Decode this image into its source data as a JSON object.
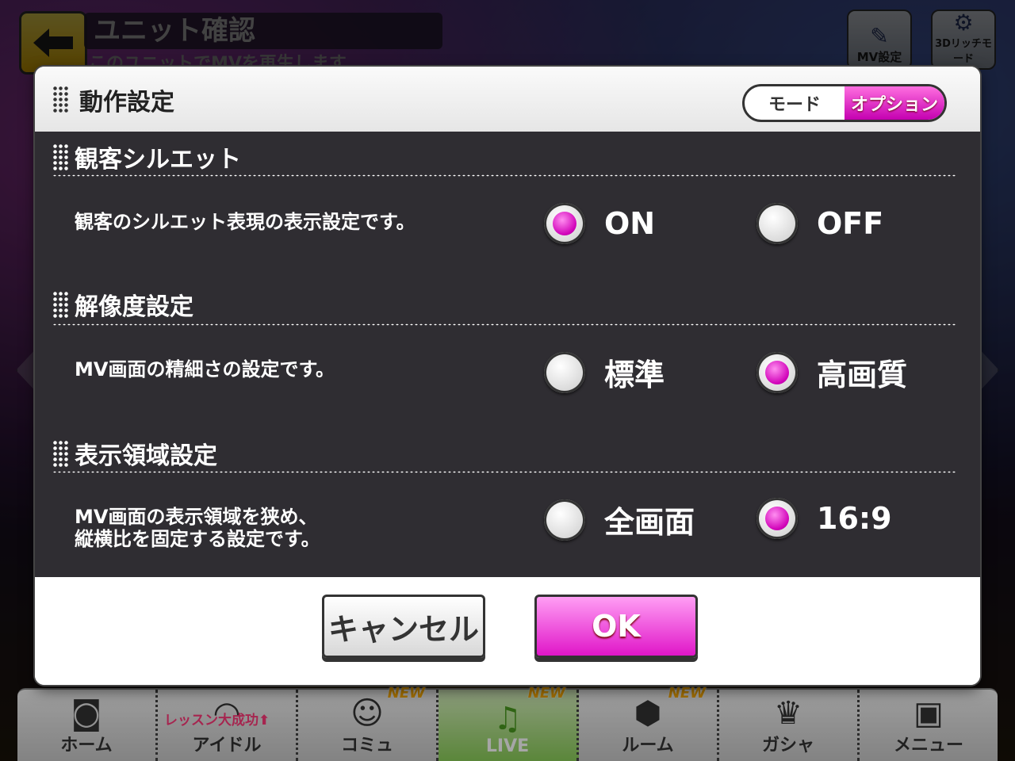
{
  "screen": {
    "title": "ユニット確認",
    "subtitle": "このユニットでMVを再生します",
    "mv_settings_label": "MV設定",
    "rich_mode_label": "3Dリッチモード"
  },
  "dialog": {
    "title": "動作設定",
    "mode_tabs": [
      {
        "label": "モード",
        "active": false
      },
      {
        "label": "オプション",
        "active": true
      }
    ],
    "sections": [
      {
        "title": "観客シルエット",
        "description": "観客のシルエット表現の表示設定です。",
        "options": [
          {
            "label": "ON",
            "selected": true
          },
          {
            "label": "OFF",
            "selected": false
          }
        ]
      },
      {
        "title": "解像度設定",
        "description": "MV画面の精細さの設定です。",
        "options": [
          {
            "label": "標準",
            "selected": false
          },
          {
            "label": "高画質",
            "selected": true
          }
        ]
      },
      {
        "title": "表示領域設定",
        "description_line1": "MV画面の表示領域を狭め、",
        "description_line2": "縦横比を固定する設定です。",
        "options": [
          {
            "label": "全画面",
            "selected": false
          },
          {
            "label": "16:9",
            "selected": true
          }
        ]
      }
    ],
    "buttons": {
      "cancel": "キャンセル",
      "ok": "OK"
    }
  },
  "bottom_nav": {
    "items": [
      {
        "label": "ホーム",
        "icon": "speaker-icon",
        "badge": ""
      },
      {
        "label": "アイドル",
        "icon": "idol-icon",
        "badge": "",
        "tag": "レッスン大成功⬆"
      },
      {
        "label": "コミュ",
        "icon": "chat-icon",
        "badge": "NEW"
      },
      {
        "label": "LIVE",
        "icon": "music-note-icon",
        "badge": "NEW",
        "active": true
      },
      {
        "label": "ルーム",
        "icon": "room-icon",
        "badge": "NEW"
      },
      {
        "label": "ガシャ",
        "icon": "crown-icon",
        "badge": ""
      },
      {
        "label": "メニュー",
        "icon": "menu-icon",
        "badge": ""
      }
    ]
  },
  "colors": {
    "accent": "#d000b8",
    "ok_button": "#e016c8",
    "back_button": "#f0b800"
  }
}
